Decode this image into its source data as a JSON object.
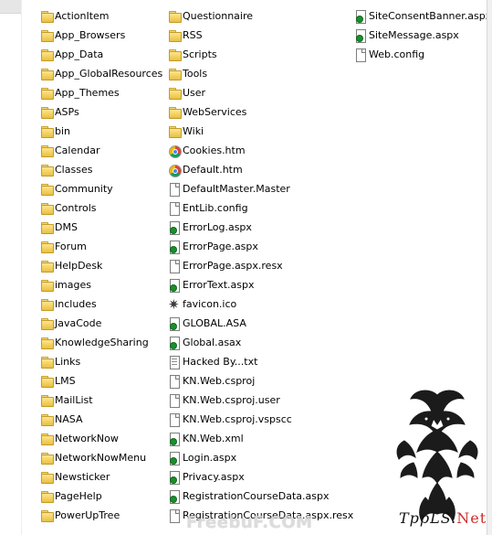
{
  "file_list": {
    "column_1": [
      {
        "name": "ActionItem",
        "type": "folder"
      },
      {
        "name": "App_Browsers",
        "type": "folder"
      },
      {
        "name": "App_Data",
        "type": "folder"
      },
      {
        "name": "App_GlobalResources",
        "type": "folder"
      },
      {
        "name": "App_Themes",
        "type": "folder"
      },
      {
        "name": "ASPs",
        "type": "folder"
      },
      {
        "name": "bin",
        "type": "folder"
      },
      {
        "name": "Calendar",
        "type": "folder"
      },
      {
        "name": "Classes",
        "type": "folder"
      },
      {
        "name": "Community",
        "type": "folder"
      },
      {
        "name": "Controls",
        "type": "folder"
      },
      {
        "name": "DMS",
        "type": "folder"
      },
      {
        "name": "Forum",
        "type": "folder"
      },
      {
        "name": "HelpDesk",
        "type": "folder"
      },
      {
        "name": "images",
        "type": "folder"
      },
      {
        "name": "Includes",
        "type": "folder"
      },
      {
        "name": "JavaCode",
        "type": "folder"
      },
      {
        "name": "KnowledgeSharing",
        "type": "folder"
      },
      {
        "name": "Links",
        "type": "folder"
      },
      {
        "name": "LMS",
        "type": "folder"
      },
      {
        "name": "MailList",
        "type": "folder"
      },
      {
        "name": "NASA",
        "type": "folder"
      },
      {
        "name": "NetworkNow",
        "type": "folder"
      },
      {
        "name": "NetworkNowMenu",
        "type": "folder"
      },
      {
        "name": "Newsticker",
        "type": "folder"
      },
      {
        "name": "PageHelp",
        "type": "folder"
      },
      {
        "name": "PowerUpTree",
        "type": "folder"
      }
    ],
    "column_2": [
      {
        "name": "Questionnaire",
        "type": "folder"
      },
      {
        "name": "RSS",
        "type": "folder"
      },
      {
        "name": "Scripts",
        "type": "folder"
      },
      {
        "name": "Tools",
        "type": "folder"
      },
      {
        "name": "User",
        "type": "folder"
      },
      {
        "name": "WebServices",
        "type": "folder"
      },
      {
        "name": "Wiki",
        "type": "folder"
      },
      {
        "name": "Cookies.htm",
        "type": "chrome"
      },
      {
        "name": "Default.htm",
        "type": "chrome"
      },
      {
        "name": "DefaultMaster.Master",
        "type": "doc"
      },
      {
        "name": "EntLib.config",
        "type": "doc"
      },
      {
        "name": "ErrorLog.aspx",
        "type": "aspx"
      },
      {
        "name": "ErrorPage.aspx",
        "type": "aspx"
      },
      {
        "name": "ErrorPage.aspx.resx",
        "type": "doc"
      },
      {
        "name": "ErrorText.aspx",
        "type": "aspx"
      },
      {
        "name": "favicon.ico",
        "type": "favicon"
      },
      {
        "name": "GLOBAL.ASA",
        "type": "aspx"
      },
      {
        "name": "Global.asax",
        "type": "aspx"
      },
      {
        "name": "Hacked By...txt",
        "type": "text"
      },
      {
        "name": "KN.Web.csproj",
        "type": "doc"
      },
      {
        "name": "KN.Web.csproj.user",
        "type": "doc"
      },
      {
        "name": "KN.Web.csproj.vspscc",
        "type": "doc"
      },
      {
        "name": "KN.Web.xml",
        "type": "aspx"
      },
      {
        "name": "Login.aspx",
        "type": "aspx"
      },
      {
        "name": "Privacy.aspx",
        "type": "aspx"
      },
      {
        "name": "RegistrationCourseData.aspx",
        "type": "aspx"
      },
      {
        "name": "RegistrationCourseData.aspx.resx",
        "type": "doc"
      }
    ],
    "column_3": [
      {
        "name": "SiteConsentBanner.aspx",
        "type": "aspx"
      },
      {
        "name": "SiteMessage.aspx",
        "type": "aspx"
      },
      {
        "name": "Web.config",
        "type": "doc"
      }
    ]
  },
  "watermarks": {
    "freebuf": "FreebuF.COM",
    "tools_logo_main": "TррLS.",
    "tools_logo_net": "Net"
  }
}
